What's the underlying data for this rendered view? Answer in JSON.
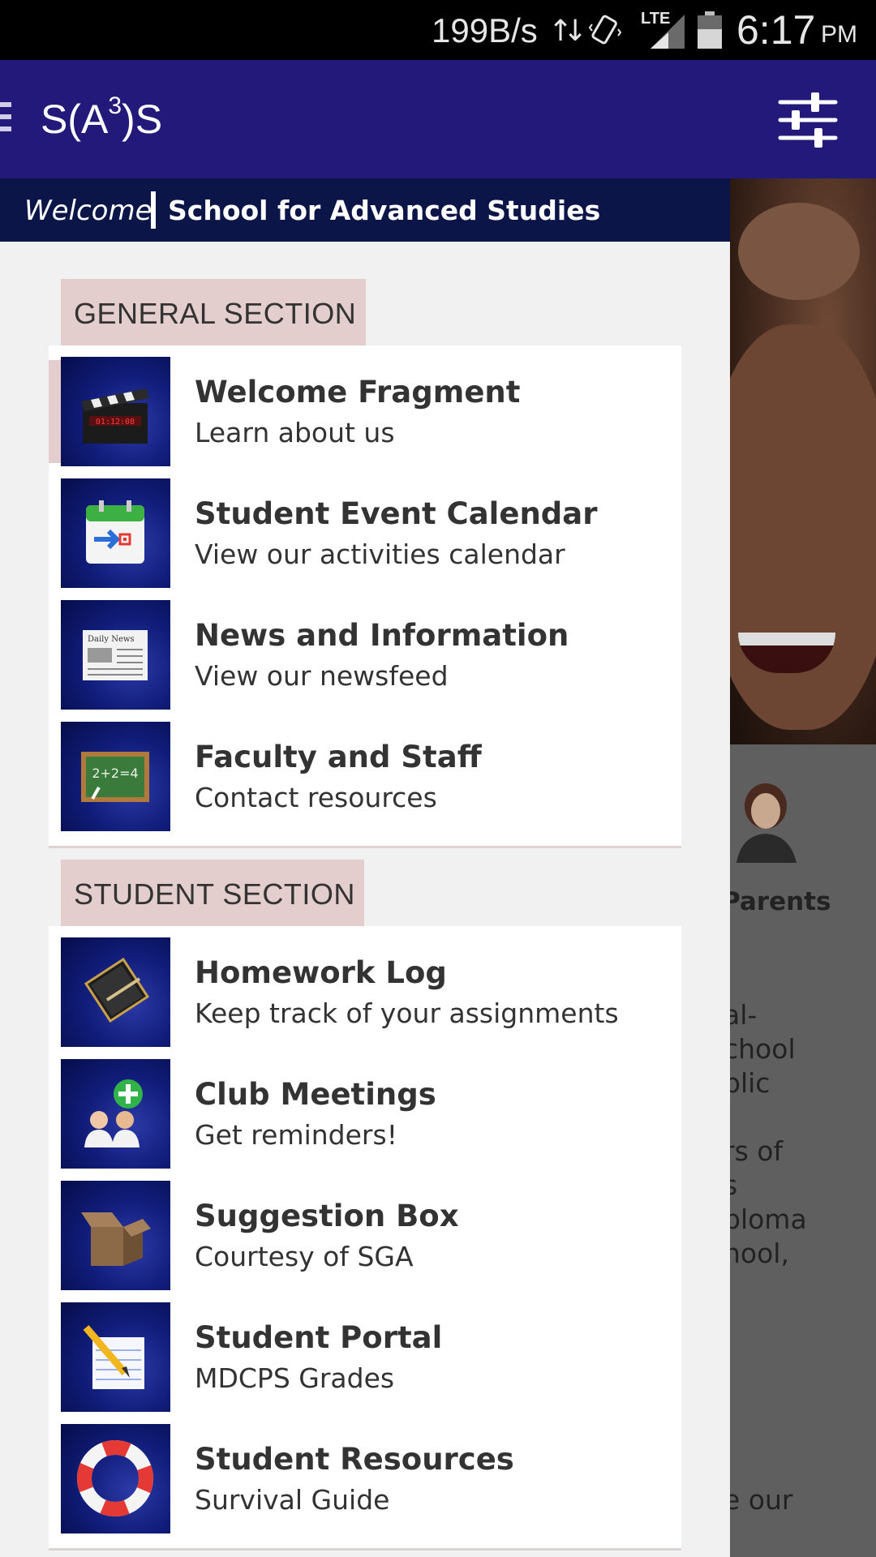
{
  "status_bar": {
    "net_speed": "199B/s",
    "time": "6:17",
    "ampm": "PM",
    "network": "LTE",
    "icons": [
      "data-transfer-icon",
      "vibrate-icon",
      "signal-icon",
      "battery-icon"
    ]
  },
  "app_bar": {
    "title_prefix": "S(A",
    "title_sup": "3",
    "title_suffix": ")S",
    "menu_icon": "hamburger-icon",
    "action_icon": "filter-sliders-icon"
  },
  "drawer": {
    "welcome": "Welcome",
    "school_name": "School for Advanced Studies",
    "sections": [
      {
        "title": "GENERAL SECTION",
        "items": [
          {
            "title": "Welcome Fragment",
            "subtitle": "Learn about us",
            "icon": "clapperboard-icon"
          },
          {
            "title": "Student Event Calendar",
            "subtitle": "View our activities calendar",
            "icon": "calendar-icon"
          },
          {
            "title": "News and Information",
            "subtitle": "View our newsfeed",
            "icon": "newspaper-icon"
          },
          {
            "title": "Faculty and Staff",
            "subtitle": "Contact resources",
            "icon": "chalkboard-icon"
          }
        ]
      },
      {
        "title": "STUDENT SECTION",
        "items": [
          {
            "title": "Homework Log",
            "subtitle": "Keep track of your assignments",
            "icon": "notebook-icon"
          },
          {
            "title": "Club Meetings",
            "subtitle": "Get reminders!",
            "icon": "add-people-icon"
          },
          {
            "title": "Suggestion Box",
            "subtitle": "Courtesy of SGA",
            "icon": "open-box-icon"
          },
          {
            "title": "Student Portal",
            "subtitle": "MDCPS Grades",
            "icon": "notepad-pencil-icon"
          },
          {
            "title": "Student Resources",
            "subtitle": "Survival Guide",
            "icon": "lifebuoy-icon"
          }
        ]
      }
    ]
  },
  "background": {
    "parents_label": "Parents",
    "text_fragments": [
      "al-",
      "chool",
      "blic",
      "rs of",
      "s",
      "ploma",
      "hool,",
      "e our"
    ]
  },
  "colors": {
    "app_bar": "#22197a",
    "welcome_bar": "#0b1547",
    "section_header": "#e3cdcd",
    "icon_tile": "#101c78"
  }
}
